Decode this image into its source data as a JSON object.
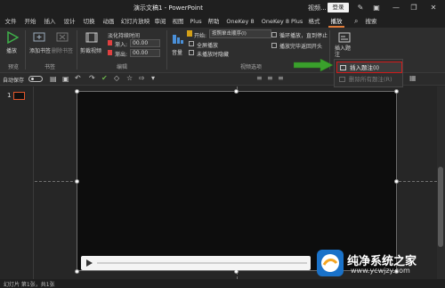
{
  "titlebar": {
    "title": "演示文稿1 - PowerPoint",
    "window_tag": "视频...",
    "login": "登录",
    "minimize": "—",
    "restore": "❐",
    "close": "✕"
  },
  "tabs": [
    "文件",
    "开始",
    "插入",
    "设计",
    "切换",
    "动画",
    "幻灯片放映",
    "审阅",
    "视图",
    "Plus",
    "帮助",
    "OneKey 8",
    "OneKey 8 Plus",
    "格式",
    "播放"
  ],
  "active_tab": "播放",
  "search_label": "搜索",
  "ribbon": {
    "play_label": "播放",
    "add_bookmark": "添加书签",
    "remove_bookmark": "删除书签",
    "trim_video": "剪裁视频",
    "fade_title": "淡化持续时间",
    "fade_in": "渐入:",
    "fade_out": "渐出:",
    "fade_in_value": "00.00",
    "fade_out_value": "00.00",
    "volume": "音量",
    "start_label": "开始:",
    "start_value": "按照单击顺序(I)",
    "fullscreen": "全屏播放",
    "hide_not_playing": "未播放时隐藏",
    "loop": "循环播放，直到停止",
    "rewind": "播放完毕返回开头",
    "insert_caption": "插入题注",
    "groups": {
      "preview": "预览",
      "bookmarks": "书签",
      "editing": "编辑",
      "video_options": "视频选项"
    }
  },
  "qat": {
    "autosave": "自动保存"
  },
  "thumb": {
    "number": "1"
  },
  "dropdown": {
    "insert": "插入题注(I)",
    "delete": "删除所有题注(R)"
  },
  "status": {
    "text": "幻灯片 第1张，共1张"
  },
  "watermark": {
    "title": "纯净系统之家",
    "url": "www.ycwjzy.com"
  },
  "colors": {
    "accent": "#e07b39",
    "highlight": "#d11a1a",
    "arrow": "#3aa02c"
  }
}
